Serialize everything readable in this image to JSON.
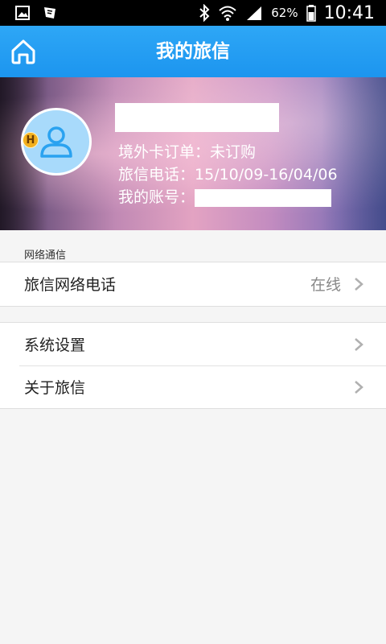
{
  "status_bar": {
    "battery_percent": "62%",
    "time": "10:41"
  },
  "header": {
    "title": "我的旅信",
    "home_icon": "home-icon"
  },
  "profile": {
    "overseas_order_label": "境外卡订单：",
    "overseas_order_value": "未订购",
    "phone_label": "旅信电话：",
    "phone_value": "15/10/09-16/04/06",
    "account_label": "我的账号：",
    "badge_text": "H"
  },
  "sections": {
    "network_header": "网络通信",
    "network_phone_label": "旅信网络电话",
    "network_phone_status": "在线",
    "system_settings_label": "系统设置",
    "about_label": "关于旅信"
  },
  "colors": {
    "header_blue": "#1f9af0",
    "avatar_bg": "#a8dafb",
    "avatar_icon": "#2aa2f0"
  }
}
